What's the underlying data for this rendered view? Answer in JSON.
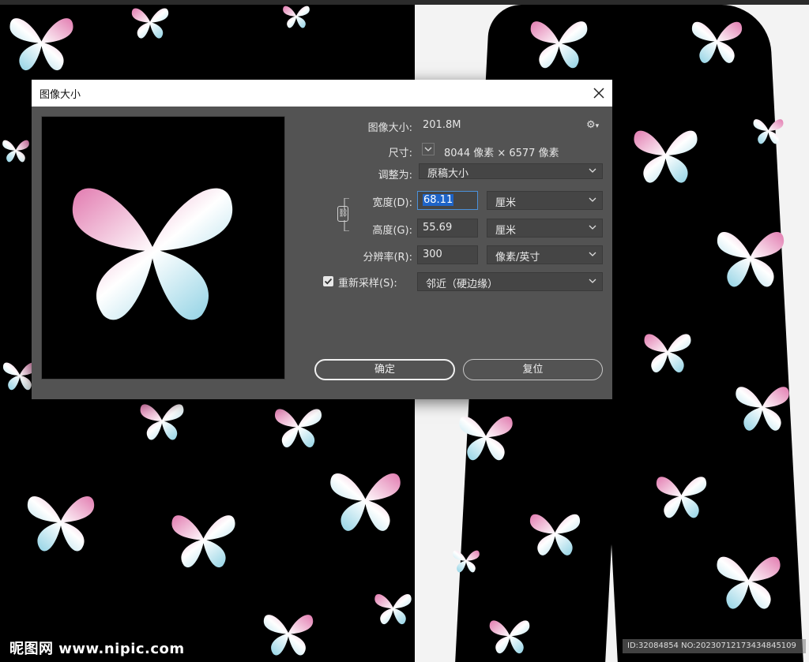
{
  "dialog": {
    "title": "图像大小",
    "image_size_label": "图像大小:",
    "image_size_value": "201.8M",
    "dimensions_label": "尺寸:",
    "dimensions_value": "8044 像素  ×  6577 像素",
    "fit_to_label": "调整为:",
    "fit_to_value": "原稿大小",
    "width_label": "宽度(D):",
    "width_value": "68.11",
    "width_unit": "厘米",
    "height_label": "高度(G):",
    "height_value": "55.69",
    "height_unit": "厘米",
    "resolution_label": "分辨率(R):",
    "resolution_value": "300",
    "resolution_unit": "像素/英寸",
    "resample_label": "重新采样(S):",
    "resample_checked": true,
    "resample_value": "邻近（硬边缘）",
    "ok_label": "确定",
    "reset_label": "复位"
  },
  "watermark": {
    "site": "昵图网 www.nipic.com",
    "id_text": "ID:32084854 NO:20230712173434845109"
  },
  "colors": {
    "dialog_bg": "#535353",
    "field_bg": "#454545",
    "selection": "#1e64c8",
    "butterfly_pink": "#e58bb5",
    "butterfly_blue": "#8fd2e3"
  }
}
